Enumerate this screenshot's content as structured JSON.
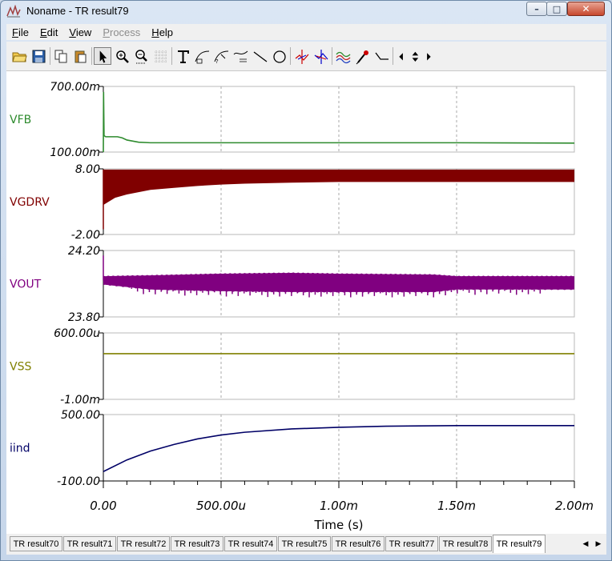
{
  "window": {
    "title": "Noname - TR result79",
    "controls": {
      "minimize": "–",
      "maximize": "□",
      "close": "✕"
    }
  },
  "menu": [
    {
      "label": "File",
      "disabled": false
    },
    {
      "label": "Edit",
      "disabled": false
    },
    {
      "label": "View",
      "disabled": false
    },
    {
      "label": "Process",
      "disabled": true
    },
    {
      "label": "Help",
      "disabled": false
    }
  ],
  "toolbar": [
    {
      "name": "open-folder-icon",
      "pressed": false
    },
    {
      "name": "save-icon",
      "pressed": false
    },
    {
      "sep": true
    },
    {
      "name": "copy-icon",
      "pressed": false
    },
    {
      "name": "paste-icon",
      "pressed": false
    },
    {
      "sep": true
    },
    {
      "name": "pointer-icon",
      "pressed": true
    },
    {
      "name": "zoom-in-icon",
      "pressed": false
    },
    {
      "name": "zoom-100-icon",
      "pressed": false
    },
    {
      "name": "grid-icon",
      "pressed": false
    },
    {
      "sep": true
    },
    {
      "name": "text-tool-icon",
      "pressed": false
    },
    {
      "name": "curve-label-1-icon",
      "pressed": false
    },
    {
      "name": "curve-label-2-icon",
      "pressed": false
    },
    {
      "name": "curve-label-3-icon",
      "pressed": false
    },
    {
      "name": "line-tool-icon",
      "pressed": false
    },
    {
      "name": "circle-tool-icon",
      "pressed": false
    },
    {
      "sep": true
    },
    {
      "name": "cursor-a-icon",
      "pressed": false
    },
    {
      "name": "cursor-b-icon",
      "pressed": false
    },
    {
      "sep": true
    },
    {
      "name": "waveform-icon",
      "pressed": false
    },
    {
      "name": "probe-icon",
      "pressed": false
    },
    {
      "name": "step-icon",
      "pressed": false
    },
    {
      "sep": true
    },
    {
      "name": "arrow-left-icon",
      "pressed": false
    },
    {
      "name": "arrow-updown-icon",
      "pressed": false
    },
    {
      "name": "arrow-right-icon",
      "pressed": false
    }
  ],
  "chart_data": {
    "type": "line",
    "xlabel": "Time (s)",
    "xlim": [
      0,
      0.002
    ],
    "x_ticks": [
      "0.00",
      "500.00u",
      "1.00m",
      "1.50m",
      "2.00m"
    ],
    "panels": [
      {
        "name": "VFB",
        "color": "#2e8b2e",
        "ymax_label": "700.00m",
        "ymin_label": "100.00m",
        "ylim": [
          0.1,
          0.7
        ],
        "x": [
          0,
          1e-06,
          3e-06,
          1e-05,
          6e-05,
          8e-05,
          0.0001,
          0.00015,
          0.0002,
          0.0005,
          0.001,
          0.0015,
          0.002
        ],
        "y": [
          0.1,
          0.65,
          0.25,
          0.24,
          0.24,
          0.23,
          0.21,
          0.19,
          0.185,
          0.185,
          0.185,
          0.185,
          0.182
        ]
      },
      {
        "name": "VGDRV",
        "color": "#800000",
        "ymax_label": "8.00",
        "ymin_label": "-2.00",
        "ylim": [
          -2,
          8
        ],
        "band_top": 7.9,
        "x": [
          0,
          5e-05,
          0.0001,
          0.0002,
          0.0003,
          0.0004,
          0.0005,
          0.0006,
          0.0008,
          0.001,
          0.0015,
          0.002
        ],
        "lower": [
          2.5,
          3.6,
          4.1,
          4.8,
          5.1,
          5.4,
          5.6,
          5.75,
          5.9,
          6.0,
          6.0,
          6.0
        ]
      },
      {
        "name": "VOUT",
        "color": "#800080",
        "ymax_label": "24.20",
        "ymin_label": "23.80",
        "ylim": [
          23.8,
          24.2
        ],
        "x": [
          0,
          0.0002,
          0.0005,
          0.0008,
          0.001,
          0.0014,
          0.0015,
          0.002
        ],
        "upper": [
          24.045,
          24.05,
          24.06,
          24.065,
          24.06,
          24.055,
          24.045,
          24.045
        ],
        "lower": [
          23.995,
          23.965,
          23.955,
          23.95,
          23.95,
          23.95,
          23.965,
          23.965
        ]
      },
      {
        "name": "VSS",
        "color": "#808000",
        "ymax_label": "600.00u",
        "ymin_label": "-1.00m",
        "ylim": [
          -0.001,
          0.0006
        ],
        "x": [
          0,
          0.002
        ],
        "y": [
          0.0001,
          0.0001
        ]
      },
      {
        "name": "iind",
        "color": "#000066",
        "ymax_label": "500.00",
        "ymin_label": "-100.00",
        "ylim": [
          -100,
          500
        ],
        "x": [
          0,
          0.0001,
          0.0002,
          0.0003,
          0.0004,
          0.0005,
          0.0006,
          0.0008,
          0.001,
          0.0012,
          0.0015,
          0.002
        ],
        "y": [
          -15,
          90,
          170,
          230,
          280,
          315,
          340,
          370,
          385,
          395,
          400,
          400
        ]
      }
    ]
  },
  "tabs": [
    "TR result70",
    "TR result71",
    "TR result72",
    "TR result73",
    "TR result74",
    "TR result75",
    "TR result76",
    "TR result77",
    "TR result78",
    "TR result79"
  ],
  "active_tab": 9,
  "tab_scroll": {
    "left": "◀",
    "right": "▶"
  }
}
